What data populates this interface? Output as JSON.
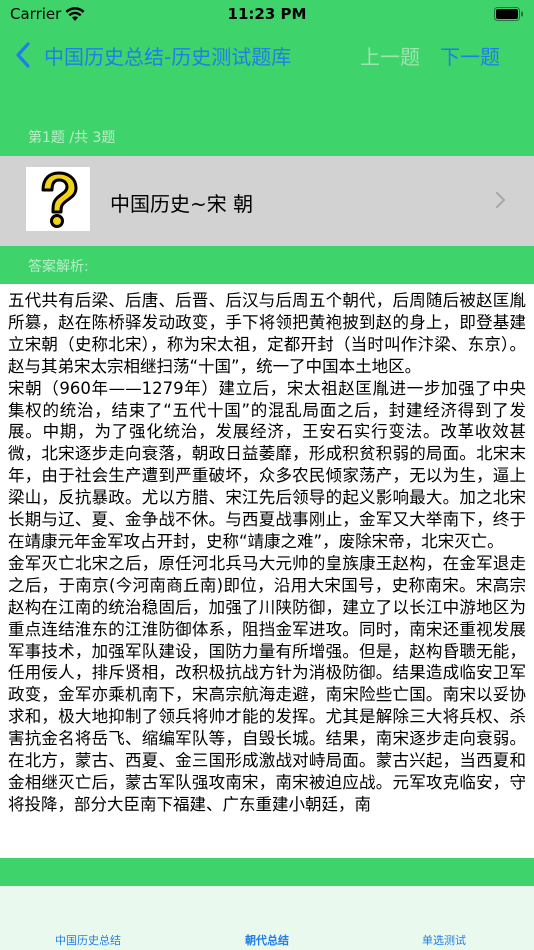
{
  "status_bar": {
    "carrier": "Carrier",
    "time": "11:23 PM"
  },
  "nav": {
    "title": "中国历史总结-历史测试题库",
    "prev_label": "上一题",
    "next_label": "下一题"
  },
  "question": {
    "counter": "第1题 /共 3题",
    "title": "中国历史~宋 朝"
  },
  "answer": {
    "label": "答案解析:",
    "paragraphs": [
      "五代共有后梁、后唐、后晋、后汉与后周五个朝代，后周随后被赵匡胤所篡，赵在陈桥驿发动政变，手下将领把黄袍披到赵的身上，即登基建立宋朝（史称北宋），称为宋太祖，定都开封（当时叫作汴梁、东京）。赵与其弟宋太宗相继扫荡“十国”，统一了中国本土地区。",
      "宋朝（960年——1279年）建立后，宋太祖赵匡胤进一步加强了中央集权的统治，结束了“五代十国”的混乱局面之后，封建经济得到了发展。中期，为了强化统治，发展经济，王安石实行变法。改革收效甚微，北宋逐步走向衰落，朝政日益萎靡，形成积贫积弱的局面。北宋末年，由于社会生产遭到严重破坏，众多农民倾家荡产，无以为生，逼上梁山，反抗暴政。尤以方腊、宋江先后领导的起义影响最大。加之北宋长期与辽、夏、金争战不休。与西夏战事刚止，金军又大举南下，终于在靖康元年金军攻占开封，史称“靖康之难”，废除宋帝，北宋灭亡。",
      "金军灭亡北宋之后，原任河北兵马大元帅的皇族康王赵构，在金军退走之后，于南京(今河南商丘南)即位，沿用大宋国号，史称南宋。宋高宗赵构在江南的统治稳固后，加强了川陕防御，建立了以长江中游地区为重点连结淮东的江淮防御体系，阻挡金军进攻。同时，南宋还重视发展军事技术，加强军队建设，国防力量有所增强。但是，赵构昏聩无能，任用佞人，排斥贤相，改积极抗战方针为消极防御。结果造成临安卫军政变，金军亦乘机南下，宋高宗航海走避，南宋险些亡国。南宋以妥协求和，极大地抑制了领兵将帅才能的发挥。尤其是解除三大将兵权、杀害抗金名将岳飞、缩编军队等，自毁长城。结果，南宋逐步走向衰弱。在北方，蒙古、西夏、金三国形成激战对峙局面。蒙古兴起，当西夏和金相继灭亡后，蒙古军队强攻南宋，南宋被迫应战。元军攻克临安，守将投降，部分大臣南下福建、广东重建小朝廷，南"
    ]
  },
  "tabs": [
    {
      "label": "中国历史总结"
    },
    {
      "label": "朝代总结"
    },
    {
      "label": "单选测试"
    }
  ],
  "colors": {
    "accent_green": "#3fd36c",
    "link_blue": "#1f7ee9",
    "disabled_green": "#9ee4ae",
    "muted_text": "#b9efc6",
    "question_row_bg": "#d2d2d2"
  },
  "icons": {
    "back": "chevron-left-icon",
    "question": "question-mark-icon",
    "disclosure": "chevron-right-icon",
    "wifi": "wifi-icon",
    "battery": "battery-icon"
  }
}
